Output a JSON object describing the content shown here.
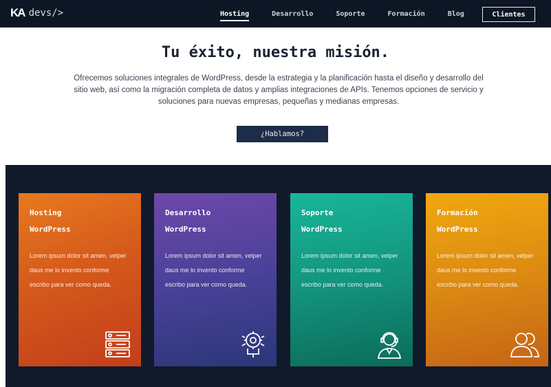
{
  "header": {
    "logo_mark": "KA",
    "logo_text": "devs/>",
    "nav": [
      {
        "label": "Hosting"
      },
      {
        "label": "Desarrollo"
      },
      {
        "label": "Soporte"
      },
      {
        "label": "Formación"
      },
      {
        "label": "Blog"
      }
    ],
    "clients_label": "Clientes"
  },
  "hero": {
    "title": "Tu éxito, nuestra misión.",
    "text": "Ofrecemos soluciones integrales de WordPress, desde la estrategia y la planificación hasta el diseño y desarrollo del sitio web, así como la migración completa de datos y amplias integraciones de APIs. Tenemos opciones de servicio y soluciones para nuevas empresas, pequeñas y medianas empresas.",
    "cta_label": "¿Hablamos?"
  },
  "cards": [
    {
      "title_1": "Hosting",
      "title_2": "WordPress",
      "text": "Lorem ipsum dolor sit amen, velper daus me lo invento conforme escribo para ver como queda.",
      "icon": "server-icon"
    },
    {
      "title_1": "Desarrollo",
      "title_2": "WordPress",
      "text": "Lorem ipsum dolor sit amen, velper daus me lo invento conforme escribo para ver como queda.",
      "icon": "brain-gear-icon"
    },
    {
      "title_1": "Soporte",
      "title_2": "WordPress",
      "text": "Lorem ipsum dolor sit amen, velper daus me lo invento conforme escribo para ver como queda.",
      "icon": "support-agent-icon"
    },
    {
      "title_1": "Formación",
      "title_2": "WordPress",
      "text": "Lorem ipsum dolor sit amen, velper daus me lo invento conforme escribo para ver como queda.",
      "icon": "users-icon"
    }
  ],
  "colors": {
    "header_bg": "#0d1625",
    "cta_bg": "#1c2c49",
    "section_bg": "#111a2a",
    "card_hosting": "#d55a1b",
    "card_desarrollo": "#4a4199",
    "card_soporte": "#13947e",
    "card_formacion": "#dc8a13"
  }
}
